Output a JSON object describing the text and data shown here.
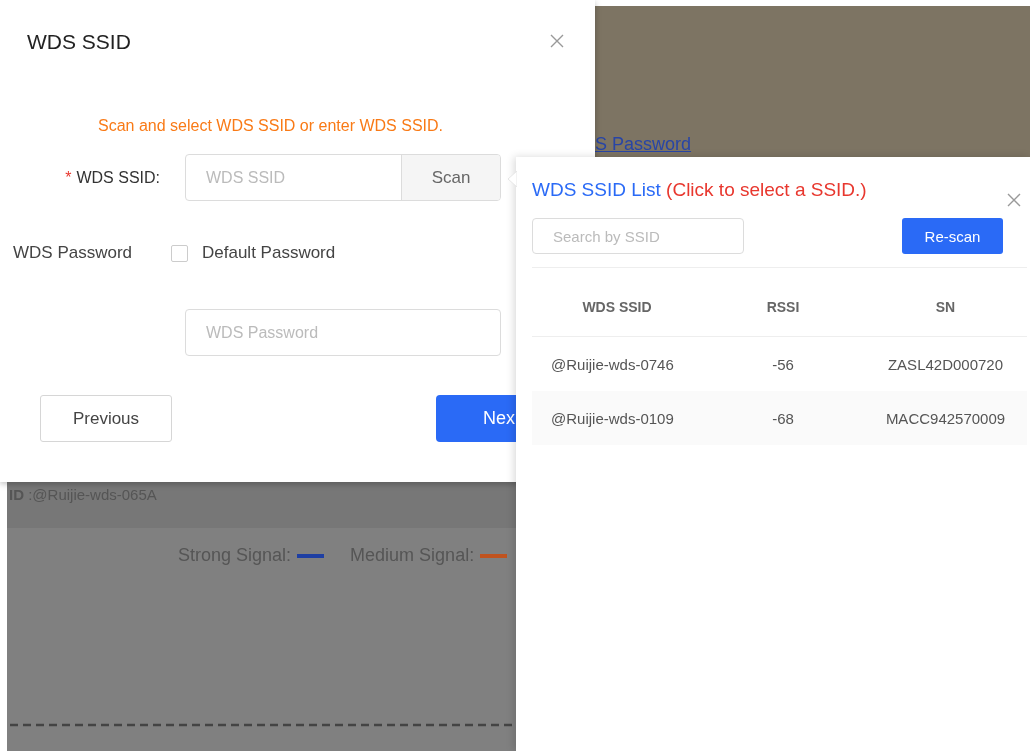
{
  "background": {
    "link": "S Password",
    "ssid_caption": "**ID** :@Ruijie-wds-065A",
    "legend": [
      {
        "label": "Strong Signal:",
        "color": "#1e3fa3"
      },
      {
        "label": "Medium Signal:",
        "color": "#c0531f"
      }
    ]
  },
  "dialog": {
    "title": "WDS SSID",
    "hint": "Scan and select WDS SSID or enter WDS SSID.",
    "ssid_field": {
      "required_mark": "*",
      "label": "WDS SSID:",
      "placeholder": "WDS SSID"
    },
    "scan_button": "Scan",
    "password_label": "WDS Password",
    "default_password": {
      "label": "Default Password",
      "checked": false
    },
    "password_field": {
      "placeholder": "WDS Password"
    },
    "previous_button": "Previous",
    "next_button": "Nex"
  },
  "ssid_list": {
    "title": "WDS SSID List",
    "title_note": "(Click to select a SSID.)",
    "search": {
      "placeholder": "Search by SSID"
    },
    "rescan_button": "Re-scan",
    "columns": [
      "WDS SSID",
      "RSSI",
      "SN"
    ],
    "rows": [
      [
        "@Ruijie-wds-0746",
        "-56",
        "ZASL42D000720"
      ],
      [
        "@Ruijie-wds-0109",
        "-68",
        "MACC942570009"
      ]
    ]
  }
}
